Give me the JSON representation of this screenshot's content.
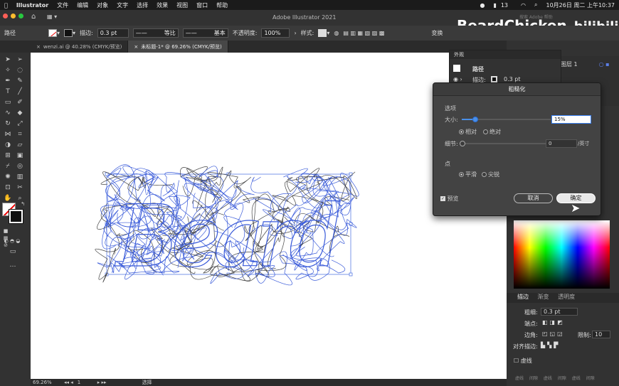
{
  "menubar": {
    "app": "Illustrator",
    "items": [
      "文件",
      "编辑",
      "对象",
      "文字",
      "选择",
      "效果",
      "视图",
      "窗口",
      "帮助"
    ],
    "right": {
      "battery": "13",
      "datetime": "10月26日 周二 上午10:37"
    }
  },
  "appbar": {
    "title": "Adobe Illustrator 2021",
    "search_placeholder": "搜索 Adobe 帮助"
  },
  "watermark": {
    "text": "BeardChicken",
    "logo": "bilibili"
  },
  "control": {
    "object": "路径",
    "stroke_label": "描边:",
    "stroke_value": "0.3 pt",
    "profile": "等比",
    "brush": "基本",
    "opacity_label": "不透明度:",
    "opacity_value": "100%",
    "style_label": "样式:",
    "right_label": "变换"
  },
  "tabs": [
    {
      "label": "wenzi.ai @ 40.28% (CMYK/预览)"
    },
    {
      "label": "未标题-1* @ 69.26% (CMYK/预览)"
    }
  ],
  "appearance": {
    "title": "外观",
    "path": "路径",
    "stroke_label": "描边:",
    "stroke_value": "0.3 pt"
  },
  "dialog": {
    "title": "粗糙化",
    "options": "选项",
    "size_label": "大小:",
    "size_value": "15%",
    "relative": "相对",
    "absolute": "绝对",
    "size_mode": "relative",
    "size_fraction": 0.15,
    "detail_label": "细节:",
    "detail_value": "0",
    "detail_unit": "/英寸",
    "points": "点",
    "smooth": "平滑",
    "corner": "尖锐",
    "points_mode": "smooth",
    "preview": "预览",
    "cancel": "取消",
    "ok": "确定"
  },
  "layers": {
    "item": "图层 1"
  },
  "stroke_panel": {
    "tabs": [
      "描边",
      "渐变",
      "透明度"
    ],
    "weight_label": "粗细:",
    "weight_value": "0.3 pt",
    "cap_label": "端点:",
    "corner_label": "边角:",
    "limit_label": "限制:",
    "limit_value": "10",
    "align_label": "对齐描边:",
    "dashed_label": "虚线",
    "dash_labels": [
      "虚线",
      "间隙",
      "虚线",
      "间隙",
      "虚线",
      "间隙"
    ]
  },
  "status": {
    "zoom": "69.26%",
    "page": "1",
    "tool": "选择"
  },
  "canvas": {
    "art_text": "Beard"
  },
  "colors": {
    "stroke_blue": "#3a5bd9",
    "accent": "#3b82f6"
  }
}
